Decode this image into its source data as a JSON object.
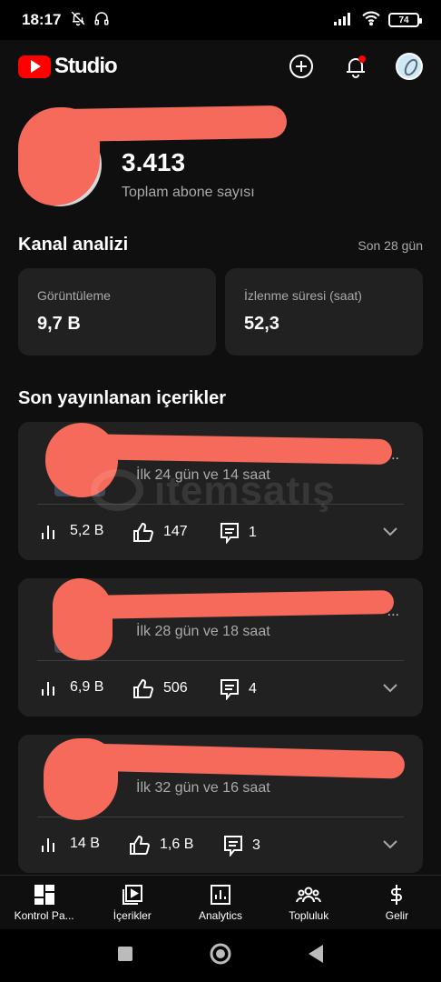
{
  "status_bar": {
    "time": "18:17",
    "battery": "74"
  },
  "app": {
    "logo_text": "Studio"
  },
  "channel": {
    "name": "",
    "subscribers": "3.413",
    "subscribers_label": "Toplam abone sayısı"
  },
  "analytics": {
    "title": "Kanal analizi",
    "period": "Son 28 gün",
    "stats": [
      {
        "label": "Görüntüleme",
        "value": "9,7 B"
      },
      {
        "label": "İzlenme süresi (saat)",
        "value": "52,3"
      }
    ]
  },
  "recent": {
    "title": "Son yayınlanan içerikler",
    "items": [
      {
        "title": "...",
        "age": "İlk 24 gün ve 14 saat",
        "views": "5,2 B",
        "likes": "147",
        "comments": "1"
      },
      {
        "title": "...",
        "age": "İlk 28 gün ve 18 saat",
        "views": "6,9 B",
        "likes": "506",
        "comments": "4"
      },
      {
        "title": "",
        "age": "İlk 32 gün ve 16 saat",
        "views": "14 B",
        "likes": "1,6 B",
        "comments": "3"
      }
    ]
  },
  "watermark": "itemsatış",
  "bottom_nav": [
    {
      "label": "Kontrol Pa...",
      "icon": "dashboard-icon"
    },
    {
      "label": "İçerikler",
      "icon": "content-icon"
    },
    {
      "label": "Analytics",
      "icon": "analytics-icon"
    },
    {
      "label": "Topluluk",
      "icon": "community-icon"
    },
    {
      "label": "Gelir",
      "icon": "earn-icon"
    }
  ]
}
